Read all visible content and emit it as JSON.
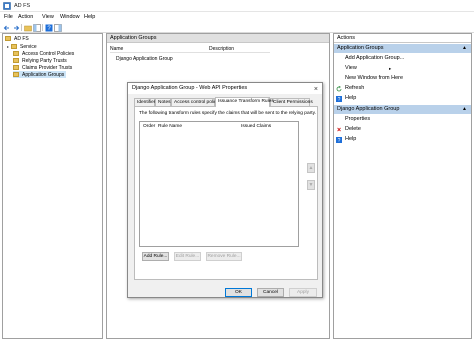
{
  "window": {
    "title": "AD FS"
  },
  "menu": [
    "File",
    "Action",
    "View",
    "Window",
    "Help"
  ],
  "tree": {
    "root": "AD FS",
    "items": [
      "Service",
      "Access Control Policies",
      "Relying Party Trusts",
      "Claims Provider Trusts",
      "Application Groups"
    ],
    "selected": "Application Groups"
  },
  "middle": {
    "header": "Application Groups",
    "columns": [
      "Name",
      "Description"
    ],
    "rows": [
      "Django Application Group"
    ]
  },
  "dialog": {
    "title": "Django Application Group - Web API Properties",
    "tabs": [
      "Identifiers",
      "Notes",
      "Access control policy",
      "Issuance Transform Rules",
      "Client Permissions"
    ],
    "active_tab": "Issuance Transform Rules",
    "description": "The following transform rules specify the claims that will be sent to the relying party.",
    "rule_columns": [
      "Order",
      "Rule Name",
      "Issued Claims"
    ],
    "buttons": {
      "add_rule": "Add Rule...",
      "edit_rule": "Edit Rule...",
      "remove_rule": "Remove Rule..."
    },
    "footer": {
      "ok": "OK",
      "cancel": "Cancel",
      "apply": "Apply"
    }
  },
  "actions": {
    "header": "Actions",
    "section1": "Application Groups",
    "section1_items": [
      "Add Application Group...",
      "View",
      "New Window from Here",
      "Refresh",
      "Help"
    ],
    "section2": "Django Application Group",
    "section2_items": [
      "Properties",
      "Delete",
      "Help"
    ]
  },
  "colors": {
    "section_bg": "#b9d1ea",
    "selection": "#cce4f7",
    "delete_icon": "#cc0000",
    "refresh_icon": "#2b8a3e",
    "help_icon": "#1e6fd9"
  }
}
